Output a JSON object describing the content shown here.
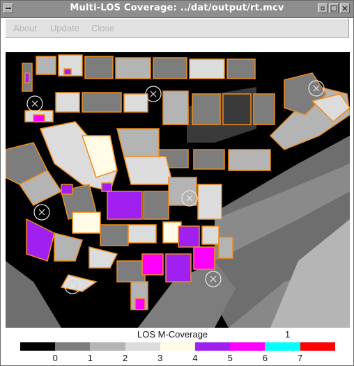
{
  "window": {
    "title": "Multi-LOS Coverage: ../dat/output/rt.mcv"
  },
  "menubar": {
    "about_label": "About",
    "update_label": "Update",
    "close_label": "Close"
  },
  "map": {
    "background_color": "#000000",
    "sea_colors": [
      "#b5b5b5",
      "#888888",
      "#6e6e6e"
    ],
    "building_outline_color": "#f08c1c",
    "receiver_marker": "circle-x-icon",
    "receiver_count": 8
  },
  "legend": {
    "title": "LOS M-Coverage",
    "value": "1",
    "classes": [
      {
        "label": "0",
        "color": "#000000"
      },
      {
        "label": "1",
        "color": "#7d7d7d"
      },
      {
        "label": "2",
        "color": "#b4b4b4"
      },
      {
        "label": "3",
        "color": "#dcdcdc"
      },
      {
        "label": "4",
        "color": "#fffbe6"
      },
      {
        "label": "5",
        "color": "#a020f0"
      },
      {
        "label": "6",
        "color": "#ff00ff"
      },
      {
        "label": "7",
        "color": "#00ffff"
      },
      {
        "label": "",
        "color": "#ff0000"
      }
    ],
    "tick_labels": [
      "0",
      "1",
      "2",
      "3",
      "4",
      "5",
      "6",
      "7"
    ]
  }
}
